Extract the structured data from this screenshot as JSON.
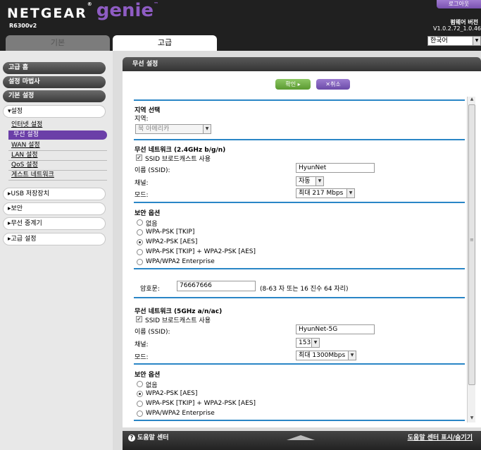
{
  "header": {
    "brand": "NETGEAR",
    "brand_mark": "®",
    "product": "genie",
    "product_mark": "™",
    "model": "R6300v2",
    "logout_label": "로그아웃",
    "firmware_label": "펌웨어 버전",
    "firmware_version": "V1.0.2.72_1.0.46",
    "language": "한국어"
  },
  "tabs": [
    {
      "label": "기본",
      "active": false
    },
    {
      "label": "고급",
      "active": true
    }
  ],
  "sidebar": {
    "top_buttons": [
      "고급 홈",
      "설정 마법사",
      "기본 설정"
    ],
    "setup_section": "▾설정",
    "setup_items": [
      {
        "label": "인터넷 설정",
        "active": false
      },
      {
        "label": "무선 설정",
        "active": true
      },
      {
        "label": "WAN 설정",
        "active": false
      },
      {
        "label": "LAN 설정",
        "active": false
      },
      {
        "label": "QoS 설정",
        "active": false
      },
      {
        "label": "게스트 네트워크",
        "active": false
      }
    ],
    "sections": [
      "▸USB 저장장치",
      "▸보안",
      "▸무선 중계기",
      "▸고급 설정"
    ]
  },
  "panel": {
    "title": "무선 설정",
    "apply_label": "확인 ▸",
    "cancel_label": "✕취소"
  },
  "region": {
    "heading": "지역 선택",
    "label": "지역:",
    "value": "북 아메리카"
  },
  "net24": {
    "heading": "무선 네트워크 (2.4GHz b/g/n)",
    "broadcast_label": "SSID 브로드캐스트 사용",
    "broadcast_checked": true,
    "name_label": "이름 (SSID):",
    "name_value": "HyunNet",
    "channel_label": "채널:",
    "channel_value": "자동",
    "mode_label": "모드:",
    "mode_value": "최대 217 Mbps"
  },
  "security24": {
    "heading": "보안 옵션",
    "options": [
      {
        "label": "없음",
        "selected": false
      },
      {
        "label": "WPA-PSK [TKIP]",
        "selected": false
      },
      {
        "label": "WPA2-PSK [AES]",
        "selected": true
      },
      {
        "label": "WPA-PSK [TKIP] + WPA2-PSK [AES]",
        "selected": false
      },
      {
        "label": "WPA/WPA2 Enterprise",
        "selected": false
      }
    ],
    "passphrase_label": "암호문:",
    "passphrase_value": "76667666",
    "passphrase_hint": "(8-63 자 또는 16 진수 64 자리)"
  },
  "net5": {
    "heading": "무선 네트워크 (5GHz a/n/ac)",
    "broadcast_label": "SSID 브로드캐스트 사용",
    "broadcast_checked": true,
    "name_label": "이름 (SSID):",
    "name_value": "HyunNet-5G",
    "channel_label": "채널:",
    "channel_value": "153",
    "mode_label": "모드:",
    "mode_value": "최대 1300Mbps"
  },
  "security5": {
    "heading": "보안 옵션",
    "options": [
      {
        "label": "없음",
        "selected": false
      },
      {
        "label": "WPA2-PSK [AES]",
        "selected": true
      },
      {
        "label": "WPA-PSK [TKIP] + WPA2-PSK [AES]",
        "selected": false
      },
      {
        "label": "WPA/WPA2 Enterprise",
        "selected": false
      }
    ]
  },
  "footer": {
    "help_center": "도움말 센터",
    "help_toggle": "도움말 센터 표시/숨기기"
  }
}
